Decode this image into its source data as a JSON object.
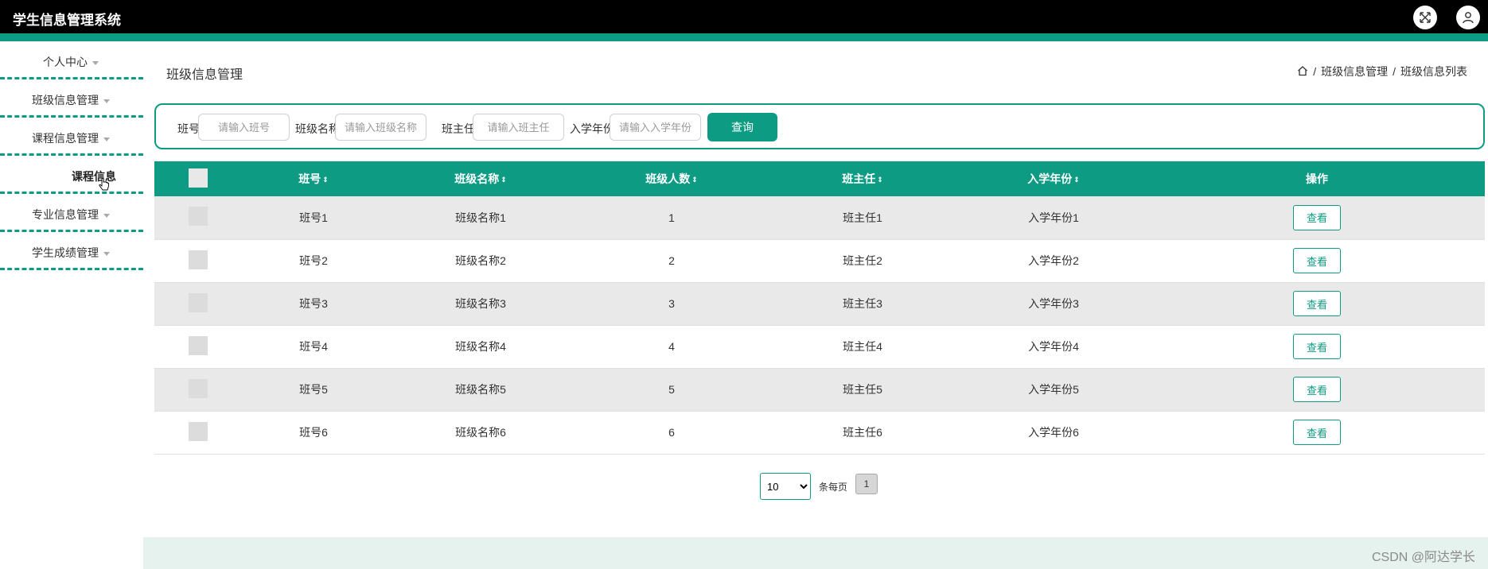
{
  "app": {
    "title": "学生信息管理系统"
  },
  "colors": {
    "accent": "#0d9b84",
    "topbar": "#000000",
    "bottom_band": "#e6f2ee"
  },
  "header_icons": [
    "fullscreen-icon",
    "user-icon"
  ],
  "sidebar": {
    "items": [
      {
        "label": "个人中心"
      },
      {
        "label": "班级信息管理"
      },
      {
        "label": "课程信息管理"
      },
      {
        "label": "课程信息"
      },
      {
        "label": "专业信息管理"
      },
      {
        "label": "学生成绩管理"
      }
    ]
  },
  "main": {
    "page_title": "班级信息管理",
    "breadcrumb": {
      "sep": "/",
      "level1": "班级信息管理",
      "level2": "班级信息列表"
    }
  },
  "search": {
    "fields": [
      {
        "label": "班号",
        "placeholder": "请输入班号"
      },
      {
        "label": "班级名称",
        "placeholder": "请输入班级名称"
      },
      {
        "label": "班主任",
        "placeholder": "请输入班主任"
      },
      {
        "label": "入学年份",
        "placeholder": "请输入入学年份"
      }
    ],
    "button": "查询"
  },
  "table": {
    "columns": [
      "班号",
      "班级名称",
      "班级人数",
      "班主任",
      "入学年份",
      "操作"
    ],
    "sort_icon": "⇕",
    "rows": [
      {
        "id": "班号1",
        "name": "班级名称1",
        "count": "1",
        "teacher": "班主任1",
        "year": "入学年份1",
        "action": "查看"
      },
      {
        "id": "班号2",
        "name": "班级名称2",
        "count": "2",
        "teacher": "班主任2",
        "year": "入学年份2",
        "action": "查看"
      },
      {
        "id": "班号3",
        "name": "班级名称3",
        "count": "3",
        "teacher": "班主任3",
        "year": "入学年份3",
        "action": "查看"
      },
      {
        "id": "班号4",
        "name": "班级名称4",
        "count": "4",
        "teacher": "班主任4",
        "year": "入学年份4",
        "action": "查看"
      },
      {
        "id": "班号5",
        "name": "班级名称5",
        "count": "5",
        "teacher": "班主任5",
        "year": "入学年份5",
        "action": "查看"
      },
      {
        "id": "班号6",
        "name": "班级名称6",
        "count": "6",
        "teacher": "班主任6",
        "year": "入学年份6",
        "action": "查看"
      }
    ]
  },
  "pagination": {
    "page_size": "10",
    "per_page_label": "条每页",
    "current_page": "1"
  },
  "watermark": "CSDN @阿达学长"
}
